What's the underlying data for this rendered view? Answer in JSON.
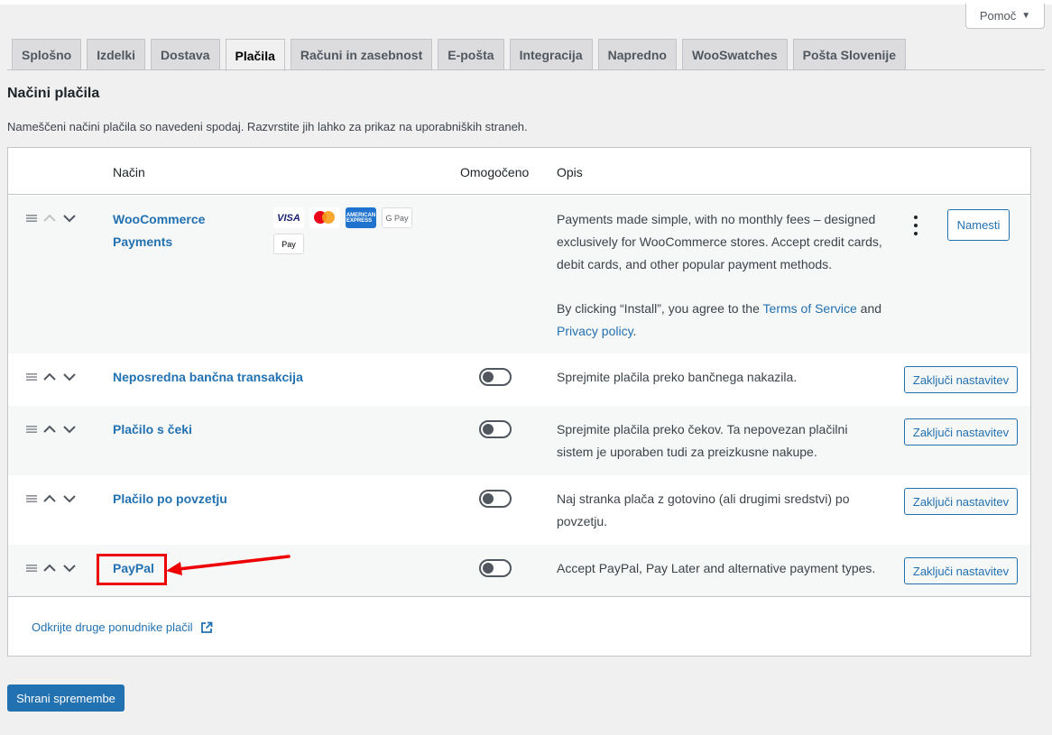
{
  "help": {
    "label": "Pomoč",
    "caret": "▼"
  },
  "tabs": [
    {
      "label": "Splošno",
      "active": false
    },
    {
      "label": "Izdelki",
      "active": false
    },
    {
      "label": "Dostava",
      "active": false
    },
    {
      "label": "Plačila",
      "active": true
    },
    {
      "label": "Računi in zasebnost",
      "active": false
    },
    {
      "label": "E-pošta",
      "active": false
    },
    {
      "label": "Integracija",
      "active": false
    },
    {
      "label": "Napredno",
      "active": false
    },
    {
      "label": "WooSwatches",
      "active": false
    },
    {
      "label": "Pošta Slovenije",
      "active": false
    }
  ],
  "page": {
    "title": "Načini plačila",
    "description": "Nameščeni načini plačila so navedeni spodaj. Razvrstite jih lahko za prikaz na uporabniških straneh."
  },
  "table": {
    "headers": {
      "method": "Način",
      "enabled": "Omogočeno",
      "description": "Opis"
    },
    "rows": [
      {
        "name_line1": "WooCommerce",
        "name_line2": "Payments",
        "desc_line1": "Payments made simple, with no monthly fees – designed",
        "desc_line2": "exclusively for WooCommerce stores. Accept credit cards,",
        "desc_line3": "debit cards, and other popular payment methods.",
        "terms_pre": "By clicking “Install”, you agree to the ",
        "terms_link": "Terms of Service",
        "terms_and": " and",
        "privacy_link": "Privacy policy",
        "privacy_post": ".",
        "button": "Namesti",
        "payment_icons": {
          "visa": "VISA",
          "amex": "AMERICAN EXPRESS",
          "gpay": "G Pay",
          "apay": " Pay"
        }
      },
      {
        "name": "Neposredna bančna transakcija",
        "desc_line1": "Sprejmite plačila preko bančnega nakazila.",
        "enabled": false,
        "button": "Zaključi nastavitev"
      },
      {
        "name": "Plačilo s čeki",
        "desc_line1": "Sprejmite plačila preko čekov. Ta nepovezan plačilni",
        "desc_line2": "sistem je uporaben tudi za preizkusne nakupe.",
        "enabled": false,
        "button": "Zaključi nastavitev"
      },
      {
        "name": "Plačilo po povzetju",
        "desc_line1": "Naj stranka plača z gotovino (ali drugimi sredstvi) po",
        "desc_line2": "povzetju.",
        "enabled": false,
        "button": "Zaključi nastavitev"
      },
      {
        "name": "PayPal",
        "desc_line1": "Accept PayPal, Pay Later and alternative payment types.",
        "enabled": false,
        "button": "Zaključi nastavitev"
      }
    ],
    "footer_link": "Odkrijte druge ponudnike plačil"
  },
  "save_button": "Shrani spremembe",
  "colors": {
    "accent": "#2271b1",
    "annotation": "#e00000"
  }
}
